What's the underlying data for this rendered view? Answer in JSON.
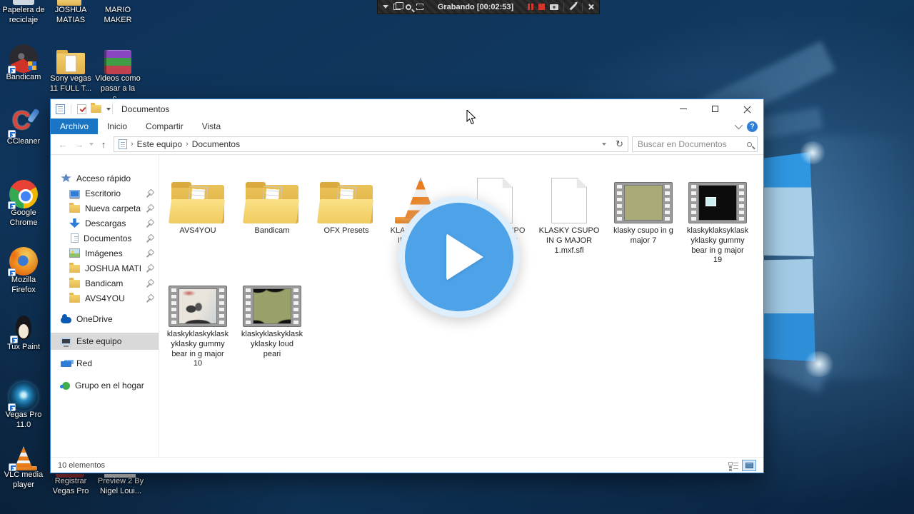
{
  "recording_bar": {
    "status_text": "Grabando [00:02:53]"
  },
  "desktop_icons": {
    "top": [
      {
        "label": "Papelera de reciclaje",
        "icon": "recycle-bin"
      },
      {
        "label": "JOSHUA MATIAS",
        "icon": "folder"
      },
      {
        "label": "MARIO MAKER",
        "icon": "folder"
      },
      {
        "label": "Bandicam",
        "icon": "bandicam"
      },
      {
        "label": "Sony vegas 11 FULL T...",
        "icon": "folder"
      },
      {
        "label": "Videos como pasar a la c...",
        "icon": "winrar"
      }
    ],
    "left": [
      {
        "label": "CCleaner",
        "icon": "ccleaner"
      },
      {
        "label": "Google Chrome",
        "icon": "chrome"
      },
      {
        "label": "Mozilla Firefox",
        "icon": "firefox"
      },
      {
        "label": "Tux Paint",
        "icon": "tux-paint"
      },
      {
        "label": "Vegas Pro 11.0",
        "icon": "vegas-pro"
      },
      {
        "label": "VLC media player",
        "icon": "vlc-cone"
      }
    ],
    "bottom": [
      {
        "label": "Registrar Vegas Pro"
      },
      {
        "label": "Preview 2 By Nigel Loui..."
      }
    ]
  },
  "explorer": {
    "window_title": "Documentos",
    "ribbon_tabs": [
      {
        "label": "Archivo"
      },
      {
        "label": "Inicio"
      },
      {
        "label": "Compartir"
      },
      {
        "label": "Vista"
      }
    ],
    "help_glyph": "?",
    "nav": {
      "back": "←",
      "forward": "→",
      "up": "↑",
      "refresh": "↻"
    },
    "breadcrumb": {
      "separator": "›",
      "items": [
        "Este equipo",
        "Documentos"
      ]
    },
    "search": {
      "placeholder": "Buscar en Documentos"
    },
    "sidebar": {
      "quick_access_label": "Acceso rápido",
      "quick_access_items": [
        {
          "label": "Escritorio",
          "icon": "desktop",
          "pinned": true
        },
        {
          "label": "Nueva carpeta",
          "icon": "folder",
          "pinned": true
        },
        {
          "label": "Descargas",
          "icon": "download-arrow",
          "pinned": true
        },
        {
          "label": "Documentos",
          "icon": "document",
          "pinned": true
        },
        {
          "label": "Imágenes",
          "icon": "pictures",
          "pinned": true
        },
        {
          "label": "JOSHUA MATIAS",
          "icon": "folder",
          "pinned": true
        },
        {
          "label": "Bandicam",
          "icon": "folder",
          "pinned": true
        },
        {
          "label": "AVS4YOU",
          "icon": "folder",
          "pinned": true
        }
      ],
      "roots": [
        {
          "label": "OneDrive",
          "icon": "onedrive-cloud"
        },
        {
          "label": "Este equipo",
          "icon": "computer",
          "selected": true
        },
        {
          "label": "Red",
          "icon": "network"
        },
        {
          "label": "Grupo en el hogar",
          "icon": "homegroup"
        }
      ]
    },
    "files": [
      {
        "lines": [
          "AVS4YOU"
        ],
        "icon": "folder"
      },
      {
        "lines": [
          "Bandicam"
        ],
        "icon": "folder"
      },
      {
        "lines": [
          "OFX Presets"
        ],
        "icon": "folder"
      },
      {
        "lines": [
          "KLASKY CSUPO",
          "IN G MAJOR"
        ],
        "icon": "vlc-cone"
      },
      {
        "lines": [
          "KLASKY CSUPO",
          "IN G MAJOR"
        ],
        "icon": "document"
      },
      {
        "lines": [
          "KLASKY CSUPO",
          "IN G MAJOR",
          "1.mxf.sfl"
        ],
        "icon": "document"
      },
      {
        "lines": [
          "klasky csupo in g",
          "major 7"
        ],
        "icon": "film-olive"
      },
      {
        "lines": [
          "klaskyklaksyklask",
          "yklasky gummy",
          "bear in g major",
          "19"
        ],
        "icon": "film-black"
      },
      {
        "lines": [
          "klaskyklaskyklask",
          "yklasky gummy",
          "bear in g major",
          "10"
        ],
        "icon": "film-scene"
      },
      {
        "lines": [
          "klaskyklaskyklask",
          "yklasky loud",
          "peari"
        ],
        "icon": "film-olive-dark-corners"
      }
    ],
    "status_bar": {
      "items_count": "10 elementos"
    }
  },
  "play_overlay": {
    "color": "#4da2e8"
  }
}
